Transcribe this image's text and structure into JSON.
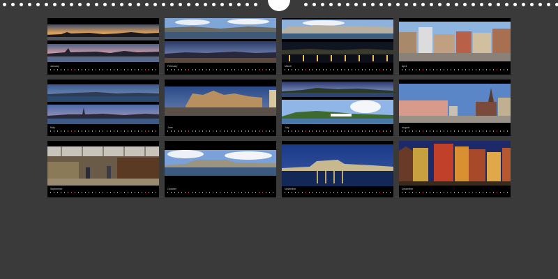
{
  "calendar": {
    "months": [
      {
        "label": "January",
        "photos": [
          "stockholm-sunset-panorama",
          "stockholm-waterfront-dusk"
        ]
      },
      {
        "label": "February",
        "photos": [
          "harbour-panorama-day",
          "harbour-panorama-evening"
        ]
      },
      {
        "label": "March",
        "photos": [
          "strandvagen-waterfront",
          "waterfront-night-lights"
        ]
      },
      {
        "label": "April",
        "photos": [
          "stortorget-square"
        ]
      },
      {
        "label": "May",
        "photos": [
          "city-skyline-dusk",
          "old-town-skyline-evening"
        ]
      },
      {
        "label": "June",
        "photos": [
          "illuminated-square-night"
        ]
      },
      {
        "label": "July",
        "photos": [
          "island-evening-panorama",
          "sailing-ship-island"
        ]
      },
      {
        "label": "August",
        "photos": [
          "palace-and-church-square"
        ]
      },
      {
        "label": "September",
        "photos": [
          "market-hall-interior"
        ]
      },
      {
        "label": "October",
        "photos": [
          "waterfront-palace-cloudy"
        ]
      },
      {
        "label": "November",
        "photos": [
          "city-hall-night-reflection"
        ]
      },
      {
        "label": "December",
        "photos": [
          "gamla-stan-colorful-facades"
        ]
      }
    ],
    "colors": {
      "background": "#3a3a3a",
      "sheet": "#000000",
      "binding_holes": "#ffffff",
      "sunday_mark": "#c03030"
    }
  }
}
